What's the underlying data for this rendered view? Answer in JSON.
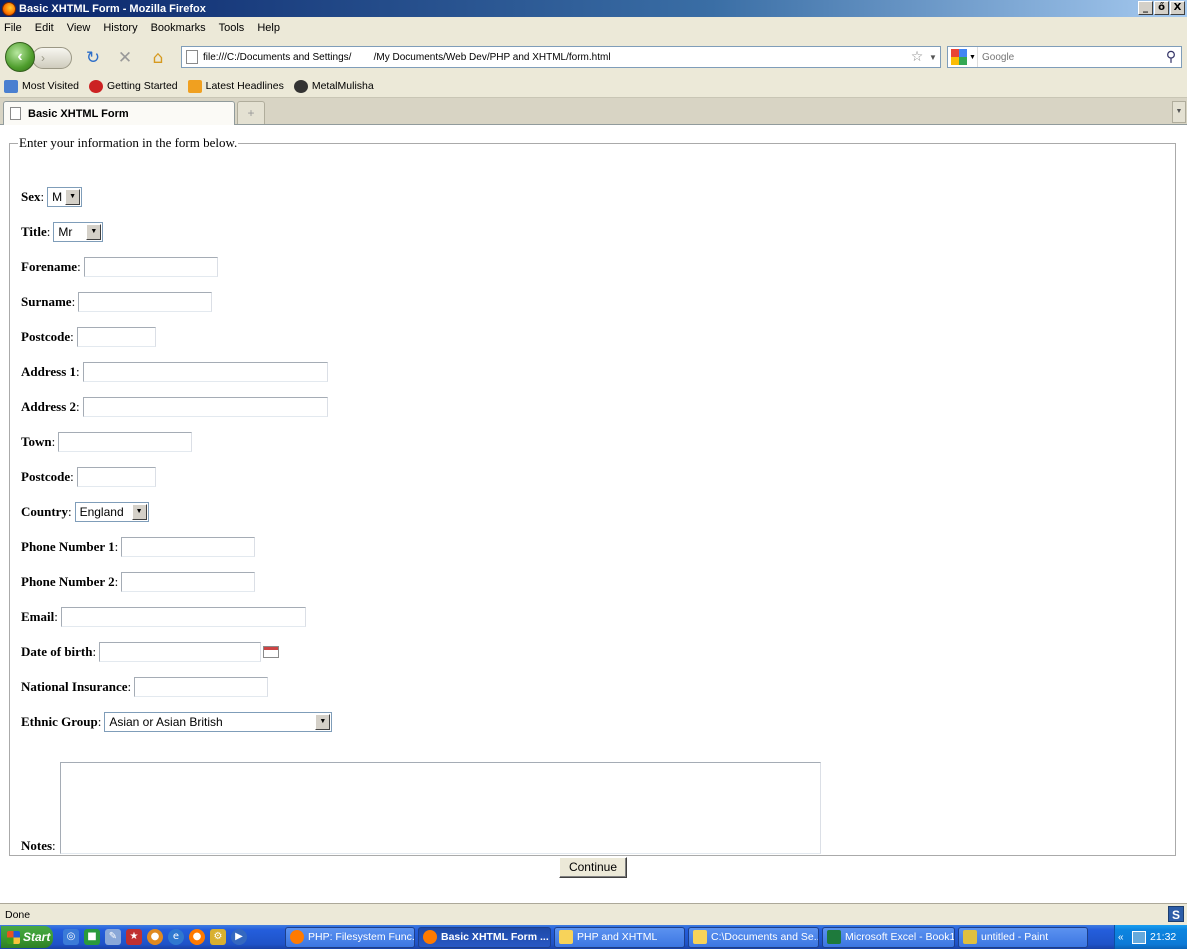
{
  "window": {
    "title": "Basic XHTML Form - Mozilla Firefox",
    "controls": [
      "_",
      "ő",
      "X"
    ]
  },
  "menu": [
    "File",
    "Edit",
    "View",
    "History",
    "Bookmarks",
    "Tools",
    "Help"
  ],
  "nav": {
    "url": "file:///C:/Documents and Settings/        /My Documents/Web Dev/PHP and XHTML/form.html",
    "search_placeholder": "Google"
  },
  "bookmarks": [
    {
      "label": "Most Visited",
      "color": "#4a7fd0"
    },
    {
      "label": "Getting Started",
      "color": "#cc2222"
    },
    {
      "label": "Latest Headlines",
      "color": "#f0a020"
    },
    {
      "label": "MetalMulisha",
      "color": "#333333"
    }
  ],
  "tab": {
    "title": "Basic XHTML Form",
    "newtab": "+"
  },
  "form": {
    "legend": "Enter your information in the form below.",
    "fields": {
      "sex": {
        "label": "Sex",
        "value": "M"
      },
      "title": {
        "label": "Title",
        "value": "Mr"
      },
      "forename": {
        "label": "Forename",
        "value": ""
      },
      "surname": {
        "label": "Surname",
        "value": ""
      },
      "postcode1": {
        "label": "Postcode",
        "value": ""
      },
      "address1": {
        "label": "Address 1",
        "value": ""
      },
      "address2": {
        "label": "Address 2",
        "value": ""
      },
      "town": {
        "label": "Town",
        "value": ""
      },
      "postcode2": {
        "label": "Postcode",
        "value": ""
      },
      "country": {
        "label": "Country",
        "value": "England"
      },
      "phone1": {
        "label": "Phone Number 1",
        "value": ""
      },
      "phone2": {
        "label": "Phone Number 2",
        "value": ""
      },
      "email": {
        "label": "Email",
        "value": ""
      },
      "dob": {
        "label": "Date of birth",
        "value": ""
      },
      "ni": {
        "label": "National Insurance",
        "value": ""
      },
      "ethnic": {
        "label": "Ethnic Group",
        "value": "Asian or Asian British"
      },
      "notes": {
        "label": "Notes",
        "value": ""
      }
    },
    "submit": "Continue"
  },
  "status": {
    "text": "Done"
  },
  "taskbar": {
    "start": "Start",
    "tasks": [
      {
        "label": "PHP: Filesystem Func...",
        "color": "#ff7a00",
        "active": false
      },
      {
        "label": "Basic XHTML Form ...",
        "color": "#ff7a00",
        "active": true
      },
      {
        "label": "PHP and XHTML",
        "color": "#f7d35a",
        "active": false
      },
      {
        "label": "C:\\Documents and Se...",
        "color": "#f7d35a",
        "active": false
      },
      {
        "label": "Microsoft Excel - Book1",
        "color": "#1e7a3c",
        "active": false
      },
      {
        "label": "untitled - Paint",
        "color": "#e0c040",
        "active": false
      }
    ],
    "clock": "21:32"
  }
}
